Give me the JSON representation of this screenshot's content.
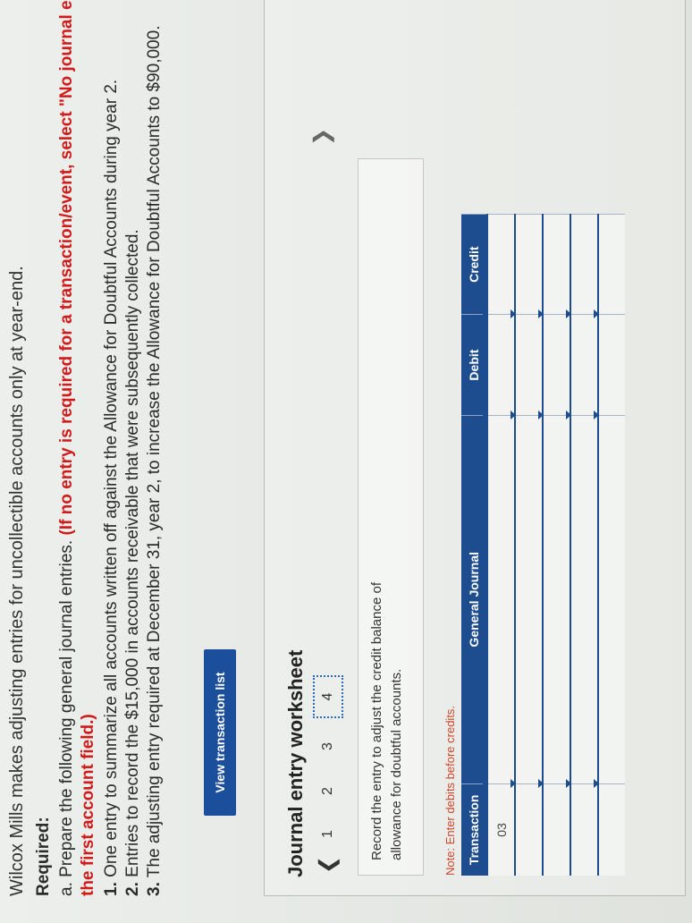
{
  "problem": {
    "intro": "Wilcox Mills makes adjusting entries for uncollectible accounts only at year-end.",
    "required_heading": "Required:",
    "part_a_prefix": "a. Prepare the following general journal entries.",
    "part_a_red": "(If no entry is required for a transaction/event, select \"No journal entry required\" in",
    "part_a_red_cont": "the first account field.)",
    "items": [
      {
        "num": "1.",
        "text": "One entry to summarize all accounts written off against the Allowance for Doubtful Accounts during year 2."
      },
      {
        "num": "2.",
        "text": "Entries to record the $15,000 in accounts receivable that were subsequently collected."
      },
      {
        "num": "3.",
        "text": "The adjusting entry required at December 31, year 2, to increase the Allowance for Doubtful Accounts to $90,000."
      }
    ]
  },
  "toolbar": {
    "view_transaction_list": "View transaction list"
  },
  "worksheet": {
    "title": "Journal entry worksheet",
    "steps": [
      "1",
      "2",
      "3",
      "4"
    ],
    "active_step": "4",
    "instruction": "Record the entry to adjust the credit balance of allowance for doubtful accounts.",
    "note": "Note: Enter debits before credits.",
    "columns": [
      "Transaction",
      "General Journal",
      "Debit",
      "Credit"
    ],
    "rows": [
      [
        "03",
        "",
        "",
        ""
      ],
      [
        "",
        "",
        "",
        ""
      ],
      [
        "",
        "",
        "",
        ""
      ],
      [
        "",
        "",
        "",
        ""
      ],
      [
        "",
        "",
        "",
        ""
      ]
    ]
  }
}
